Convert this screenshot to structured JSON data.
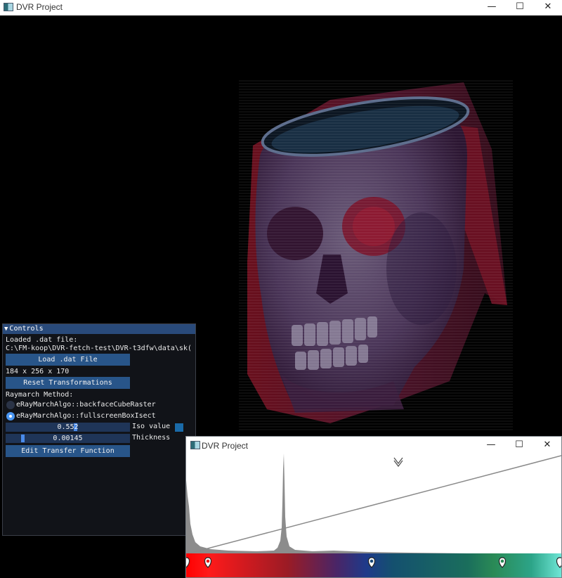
{
  "window": {
    "title": "DVR Project",
    "minimize": "—",
    "maximize": "☐",
    "close": "✕"
  },
  "controls": {
    "header": "Controls",
    "loaded_label": "Loaded .dat file:",
    "loaded_path": "C:\\FM-koop\\DVR-fetch-test\\DVR-t3dfw\\data\\sk(",
    "load_button": "Load .dat File",
    "dimensions": "184 x 256 x 170",
    "reset_button": "Reset Transformations",
    "raymarch_label": "Raymarch Method:",
    "methods": [
      {
        "label": "eRayMarchAlgo::backfaceCubeRaster",
        "selected": false
      },
      {
        "label": "eRayMarchAlgo::fullscreenBoxIsect",
        "selected": true
      }
    ],
    "iso": {
      "value": "0.552",
      "label": "Iso value",
      "fraction": 0.552,
      "color": "#1a6aa8"
    },
    "thickness": {
      "value": "0.00145",
      "label": "Thickness",
      "fraction": 0.145
    },
    "edit_tf_button": "Edit Transfer Function"
  },
  "transfer_window": {
    "title": "DVR Project",
    "minimize": "—",
    "maximize": "☐",
    "close": "✕",
    "gradient_colors": [
      "#ff0000",
      "#9b1b25",
      "#1e3a8a",
      "#1a6e5c",
      "#2ca488",
      "#6fe6d6"
    ]
  }
}
